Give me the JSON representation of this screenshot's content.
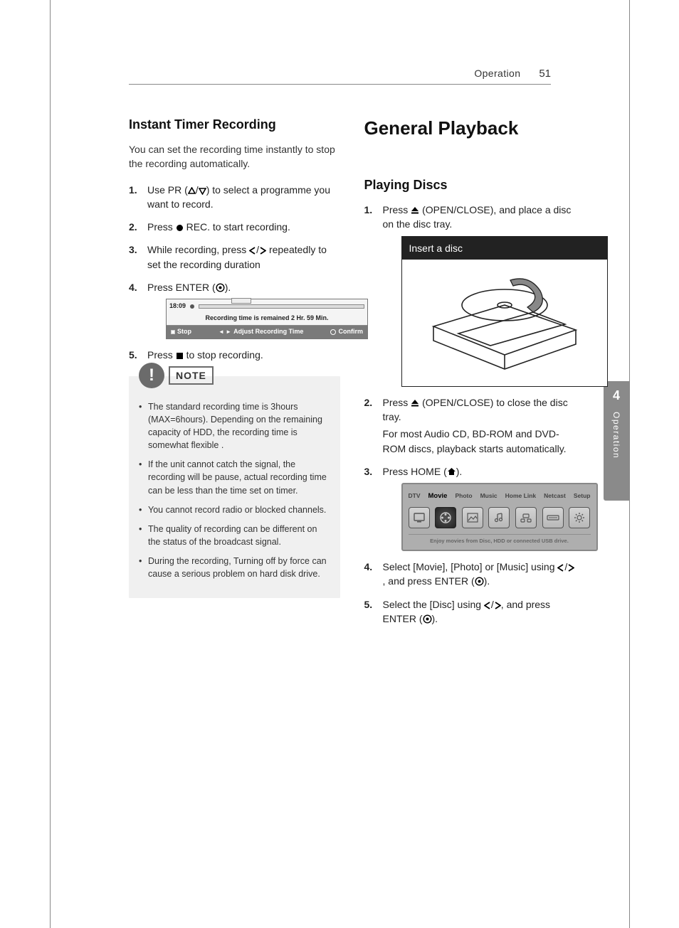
{
  "header": {
    "section": "Operation",
    "page": "51"
  },
  "sideTab": {
    "num": "4",
    "label": "Operation"
  },
  "left": {
    "heading": "Instant Timer Recording",
    "intro": "You can set the recording time instantly to stop the recording automatically.",
    "steps": {
      "s1a": "Use PR (",
      "s1b": "/",
      "s1c": ") to select a programme you want to record.",
      "s2a": "Press ",
      "s2b": " REC. to start recording.",
      "s3a": "While recording, press ",
      "s3b": "/",
      "s3c": " repeatedly to set the recording duration",
      "s4a": "Press ENTER (",
      "s4b": ").",
      "s5a": "Press ",
      "s5b": " to stop recording."
    },
    "recBar": {
      "time": "18:09",
      "line2": "Recording time is remained 2 Hr. 59 Min.",
      "stop": "Stop",
      "adjust": "Adjust Recording Time",
      "confirm": "Confirm"
    },
    "note": {
      "label": "NOTE",
      "items": [
        "The standard recording time is 3hours (MAX=6hours). Depending on the remaining capacity of HDD, the recording time is somewhat flexible .",
        "If the unit cannot catch the signal, the recording will be pause, actual recording time can be less than the time set on timer.",
        "You cannot record radio or blocked channels.",
        "The quality of recording can be different on the status of the broadcast signal.",
        "During the recording, Turning off by force can cause a serious problem on hard disk drive."
      ]
    }
  },
  "right": {
    "mainHeading": "General Playback",
    "subHeading": "Playing Discs",
    "steps": {
      "s1a": "Press ",
      "s1b": " (OPEN/CLOSE), and place a disc on the disc tray.",
      "discTitle": "Insert a disc",
      "s2a": "Press ",
      "s2b": " (OPEN/CLOSE) to close the disc tray.",
      "s2sub": "For most Audio CD, BD-ROM and DVD-ROM discs, playback starts automatically.",
      "s3a": "Press HOME (",
      "s3b": ").",
      "s4a": "Select [Movie], [Photo] or [Music] using ",
      "s4b": "/",
      "s4c": ", and press ENTER (",
      "s4d": ").",
      "s5a": "Select the [Disc] using ",
      "s5b": "/",
      "s5c": ", and press ENTER (",
      "s5d": ")."
    },
    "homeMenu": {
      "tabs": [
        "DTV",
        "Movie",
        "Photo",
        "Music",
        "Home Link",
        "Netcast",
        "Setup"
      ],
      "sub": "Enjoy movies from Disc, HDD or connected USB drive."
    }
  }
}
